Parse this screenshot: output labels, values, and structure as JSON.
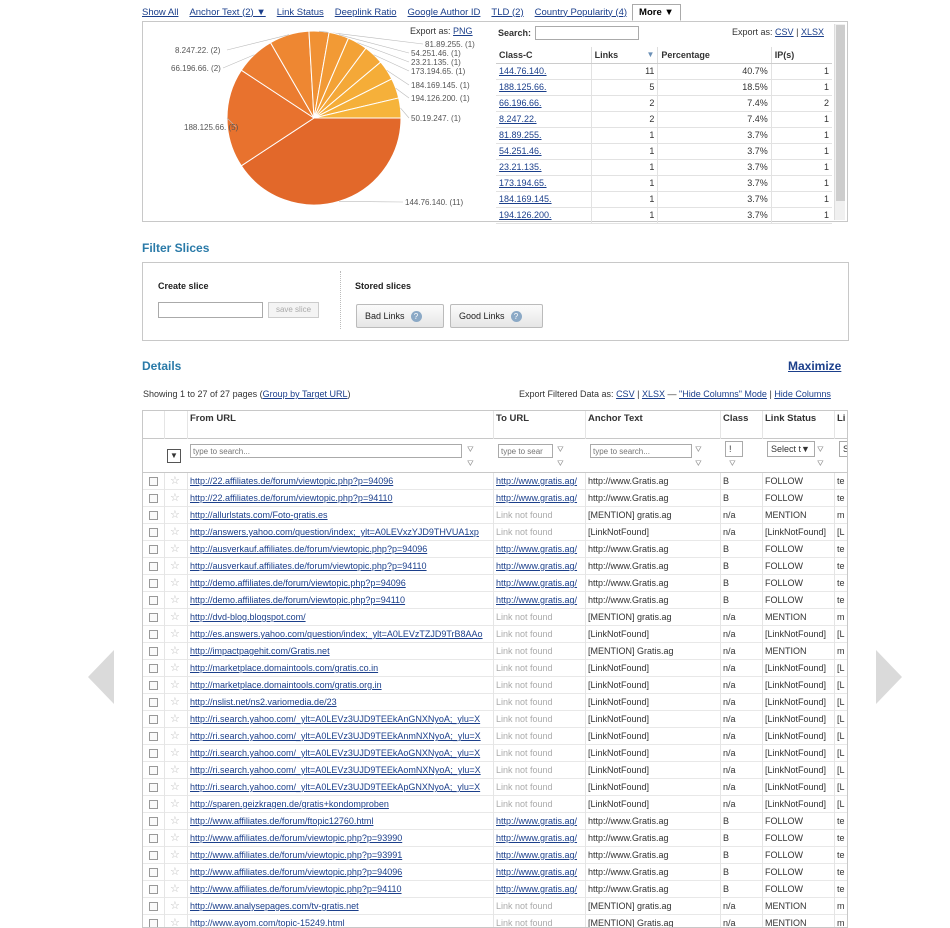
{
  "tabs": [
    {
      "label": "Show All"
    },
    {
      "label": "Anchor Text (2) ▼"
    },
    {
      "label": "Link Status"
    },
    {
      "label": "Deeplink Ratio"
    },
    {
      "label": "Google Author ID"
    },
    {
      "label": "TLD (2)"
    },
    {
      "label": "Country Popularity (4)"
    },
    {
      "label": "More ▼"
    }
  ],
  "chart": {
    "export_prefix": "Export as:",
    "export_png": "PNG",
    "chart_data": {
      "type": "pie",
      "slices": [
        {
          "label": "144.76.140. (11)",
          "value": 11,
          "color": "#e2682a"
        },
        {
          "label": "188.125.66. (5)",
          "value": 5,
          "color": "#e8722e"
        },
        {
          "label": "66.196.66. (2)",
          "value": 2,
          "color": "#eb7c30"
        },
        {
          "label": "8.247.22. (2)",
          "value": 2,
          "color": "#ee8732"
        },
        {
          "label": "81.89.255. (1)",
          "value": 1,
          "color": "#f09134"
        },
        {
          "label": "54.251.46. (1)",
          "value": 1,
          "color": "#f29a35"
        },
        {
          "label": "23.21.135. (1)",
          "value": 1,
          "color": "#f3a236"
        },
        {
          "label": "173.194.65. (1)",
          "value": 1,
          "color": "#f4a838"
        },
        {
          "label": "184.169.145. (1)",
          "value": 1,
          "color": "#f5ad38"
        },
        {
          "label": "194.126.200. (1)",
          "value": 1,
          "color": "#f5b03a"
        },
        {
          "label": "50.19.247. (1)",
          "value": 1,
          "color": "#f6b43b"
        }
      ]
    }
  },
  "class_table": {
    "search_label": "Search:",
    "export_prefix": "Export as:",
    "export_csv": "CSV",
    "export_sep": "|",
    "export_xlsx": "XLSX",
    "headers": [
      "Class-C",
      "Links",
      "Percentage",
      "IP(s)"
    ],
    "rows": [
      {
        "c": "144.76.140.",
        "links": "11",
        "pct": "40.7%",
        "ips": "1"
      },
      {
        "c": "188.125.66.",
        "links": "5",
        "pct": "18.5%",
        "ips": "1"
      },
      {
        "c": "66.196.66.",
        "links": "2",
        "pct": "7.4%",
        "ips": "2"
      },
      {
        "c": "8.247.22.",
        "links": "2",
        "pct": "7.4%",
        "ips": "1"
      },
      {
        "c": "81.89.255.",
        "links": "1",
        "pct": "3.7%",
        "ips": "1"
      },
      {
        "c": "54.251.46.",
        "links": "1",
        "pct": "3.7%",
        "ips": "1"
      },
      {
        "c": "23.21.135.",
        "links": "1",
        "pct": "3.7%",
        "ips": "1"
      },
      {
        "c": "173.194.65.",
        "links": "1",
        "pct": "3.7%",
        "ips": "1"
      },
      {
        "c": "184.169.145.",
        "links": "1",
        "pct": "3.7%",
        "ips": "1"
      },
      {
        "c": "194.126.200.",
        "links": "1",
        "pct": "3.7%",
        "ips": "1"
      }
    ]
  },
  "filter": {
    "title": "Filter Slices",
    "create_label": "Create slice",
    "save_label": "save slice",
    "stored_label": "Stored slices",
    "stored": [
      "Bad Links",
      "Good Links"
    ],
    "help_glyph": "?"
  },
  "details": {
    "title": "Details",
    "maximize": "Maximize",
    "showing": "Showing 1 to 27 of 27 pages (",
    "group_link": "Group by Target URL",
    "showing_end": ")",
    "export_prefix": "Export Filtered Data as:",
    "export_csv": "CSV",
    "export_xlsx": "XLSX",
    "dash": "—",
    "hide_mode": "\"Hide Columns\" Mode",
    "hide_cols": "Hide Columns",
    "sep": "|",
    "columns": [
      "From URL",
      "To URL",
      "Anchor Text",
      "Class",
      "Link Status",
      "Li"
    ],
    "filters": {
      "placeholder": "type to search...",
      "to_placeholder": "type to sear",
      "class_select": "!",
      "status_select": "Select t▼",
      "last_select": "S"
    },
    "rows": [
      [
        "http://22.affiliates.de/forum/viewtopic.php?p=94096",
        "http://www.gratis.ag/",
        "http://www.Gratis.ag",
        "B",
        "FOLLOW",
        "te"
      ],
      [
        "http://22.affiliates.de/forum/viewtopic.php?p=94110",
        "http://www.gratis.ag/",
        "http://www.Gratis.ag",
        "B",
        "FOLLOW",
        "te"
      ],
      [
        "http://allurlstats.com/Foto-gratis.es",
        "Link not found",
        "[MENTION] gratis.ag",
        "n/a",
        "MENTION",
        "m"
      ],
      [
        "http://answers.yahoo.com/question/index;_ylt=A0LEVxzYJD9THVUA1xp",
        "Link not found",
        "[LinkNotFound]",
        "n/a",
        "[LinkNotFound]",
        "[L"
      ],
      [
        "http://ausverkauf.affiliates.de/forum/viewtopic.php?p=94096",
        "http://www.gratis.ag/",
        "http://www.Gratis.ag",
        "B",
        "FOLLOW",
        "te"
      ],
      [
        "http://ausverkauf.affiliates.de/forum/viewtopic.php?p=94110",
        "http://www.gratis.ag/",
        "http://www.Gratis.ag",
        "B",
        "FOLLOW",
        "te"
      ],
      [
        "http://demo.affiliates.de/forum/viewtopic.php?p=94096",
        "http://www.gratis.ag/",
        "http://www.Gratis.ag",
        "B",
        "FOLLOW",
        "te"
      ],
      [
        "http://demo.affiliates.de/forum/viewtopic.php?p=94110",
        "http://www.gratis.ag/",
        "http://www.Gratis.ag",
        "B",
        "FOLLOW",
        "te"
      ],
      [
        "http://dvd-blog.blogspot.com/",
        "Link not found",
        "[MENTION] gratis.ag",
        "n/a",
        "MENTION",
        "m"
      ],
      [
        "http://es.answers.yahoo.com/question/index;_ylt=A0LEVzTZJD9TrB8AAo",
        "Link not found",
        "[LinkNotFound]",
        "n/a",
        "[LinkNotFound]",
        "[L"
      ],
      [
        "http://impactpagehit.com/Gratis.net",
        "Link not found",
        "[MENTION] Gratis.ag",
        "n/a",
        "MENTION",
        "m"
      ],
      [
        "http://marketplace.domaintools.com/gratis.co.in",
        "Link not found",
        "[LinkNotFound]",
        "n/a",
        "[LinkNotFound]",
        "[L"
      ],
      [
        "http://marketplace.domaintools.com/gratis.org.in",
        "Link not found",
        "[LinkNotFound]",
        "n/a",
        "[LinkNotFound]",
        "[L"
      ],
      [
        "http://nslist.net/ns2.variomedia.de/23",
        "Link not found",
        "[LinkNotFound]",
        "n/a",
        "[LinkNotFound]",
        "[L"
      ],
      [
        "http://ri.search.yahoo.com/_ylt=A0LEVz3UJD9TEEkAnGNXNyoA;_ylu=X",
        "Link not found",
        "[LinkNotFound]",
        "n/a",
        "[LinkNotFound]",
        "[L"
      ],
      [
        "http://ri.search.yahoo.com/_ylt=A0LEVz3UJD9TEEkAnmNXNyoA;_ylu=X",
        "Link not found",
        "[LinkNotFound]",
        "n/a",
        "[LinkNotFound]",
        "[L"
      ],
      [
        "http://ri.search.yahoo.com/_ylt=A0LEVz3UJD9TEEkAoGNXNyoA;_ylu=X",
        "Link not found",
        "[LinkNotFound]",
        "n/a",
        "[LinkNotFound]",
        "[L"
      ],
      [
        "http://ri.search.yahoo.com/_ylt=A0LEVz3UJD9TEEkAomNXNyoA;_ylu=X",
        "Link not found",
        "[LinkNotFound]",
        "n/a",
        "[LinkNotFound]",
        "[L"
      ],
      [
        "http://ri.search.yahoo.com/_ylt=A0LEVz3UJD9TEEkApGNXNyoA;_ylu=X",
        "Link not found",
        "[LinkNotFound]",
        "n/a",
        "[LinkNotFound]",
        "[L"
      ],
      [
        "http://sparen.geizkragen.de/gratis+kondomproben",
        "Link not found",
        "[LinkNotFound]",
        "n/a",
        "[LinkNotFound]",
        "[L"
      ],
      [
        "http://www.affiliates.de/forum/ftopic12760.html",
        "http://www.gratis.ag/",
        "http://www.Gratis.ag",
        "B",
        "FOLLOW",
        "te"
      ],
      [
        "http://www.affiliates.de/forum/viewtopic.php?p=93990",
        "http://www.gratis.ag/",
        "http://www.Gratis.ag",
        "B",
        "FOLLOW",
        "te"
      ],
      [
        "http://www.affiliates.de/forum/viewtopic.php?p=93991",
        "http://www.gratis.ag/",
        "http://www.Gratis.ag",
        "B",
        "FOLLOW",
        "te"
      ],
      [
        "http://www.affiliates.de/forum/viewtopic.php?p=94096",
        "http://www.gratis.ag/",
        "http://www.Gratis.ag",
        "B",
        "FOLLOW",
        "te"
      ],
      [
        "http://www.affiliates.de/forum/viewtopic.php?p=94110",
        "http://www.gratis.ag/",
        "http://www.Gratis.ag",
        "B",
        "FOLLOW",
        "te"
      ],
      [
        "http://www.analysepages.com/tv-gratis.net",
        "Link not found",
        "[MENTION] gratis.ag",
        "n/a",
        "MENTION",
        "m"
      ],
      [
        "http://www.ayom.com/topic-15249.html",
        "Link not found",
        "[MENTION] Gratis.ag",
        "n/a",
        "MENTION",
        "m"
      ]
    ]
  }
}
